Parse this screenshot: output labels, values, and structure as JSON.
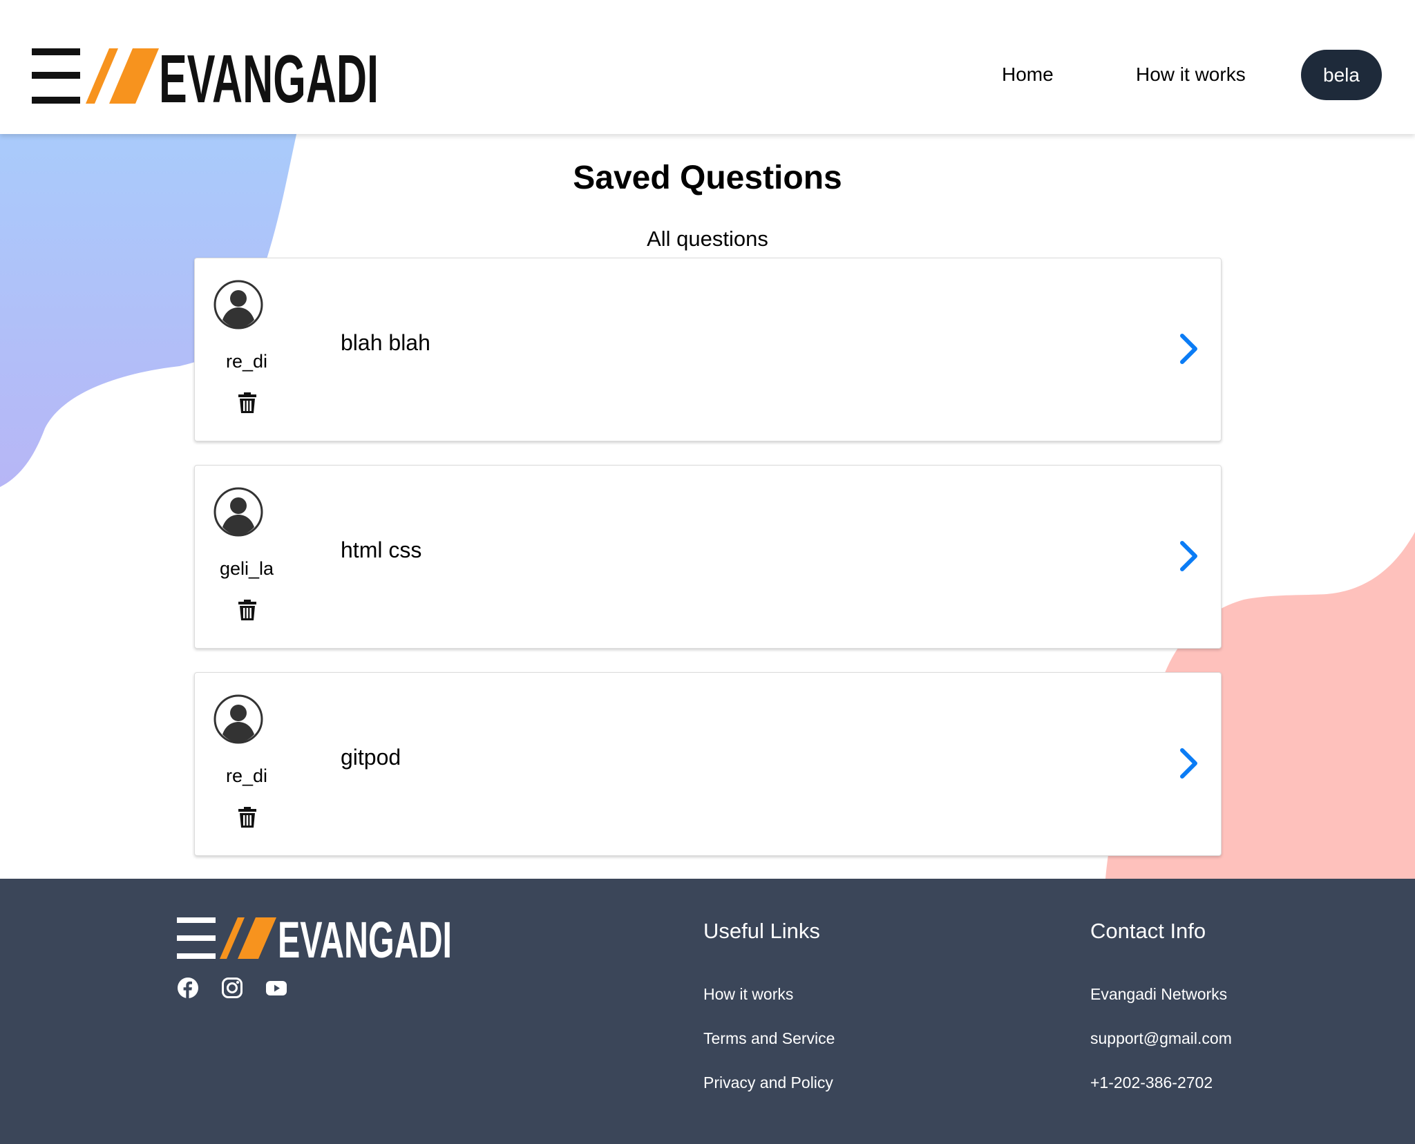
{
  "header": {
    "logo_text": "EVANGADI",
    "nav": [
      {
        "label": "Home"
      },
      {
        "label": "How it works"
      }
    ],
    "user_button": "bela"
  },
  "main": {
    "title": "Saved Questions",
    "section_label": "All questions",
    "questions": [
      {
        "username": "re_di",
        "question": "blah blah"
      },
      {
        "username": "geli_la",
        "question": "html css"
      },
      {
        "username": "re_di",
        "question": "gitpod"
      }
    ]
  },
  "footer": {
    "logo_text": "EVANGADI",
    "social_icons": [
      "facebook-icon",
      "instagram-icon",
      "youtube-icon"
    ],
    "useful_links": {
      "heading": "Useful Links",
      "links": [
        "How it works",
        "Terms and Service",
        "Privacy and Policy"
      ]
    },
    "contact_info": {
      "heading": "Contact Info",
      "items": [
        "Evangadi Networks",
        "support@gmail.com",
        "+1-202-386-2702"
      ]
    }
  },
  "colors": {
    "accent_orange": "#f7931e",
    "dark_navy": "#1e2a3a",
    "footer_bg": "#3b4659",
    "chevron_blue": "#0b7cf5",
    "blob_blue": "#a9c6fb",
    "blob_pink": "#fec1bc"
  }
}
